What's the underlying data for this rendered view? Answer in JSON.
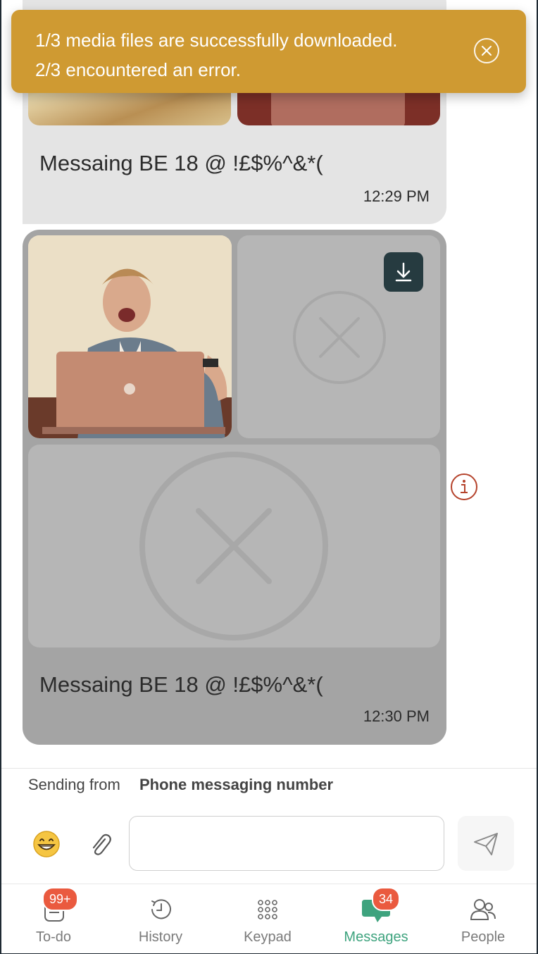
{
  "toast": {
    "line1": "1/3 media files are successfully downloaded.",
    "line2": "2/3 encountered an error."
  },
  "messages": [
    {
      "text": "Messaing BE 18 @ !£$%^&*(",
      "time": "12:29 PM"
    },
    {
      "text": "Messaing BE 18 @ !£$%^&*(",
      "time": "12:30 PM"
    }
  ],
  "composer": {
    "sending_label": "Sending from",
    "sending_number": "Phone messaging number",
    "input_value": "",
    "input_placeholder": ""
  },
  "nav": {
    "items": [
      {
        "label": "To-do",
        "badge": "99+"
      },
      {
        "label": "History"
      },
      {
        "label": "Keypad"
      },
      {
        "label": "Messages",
        "badge": "34",
        "active": true
      },
      {
        "label": "People"
      }
    ]
  },
  "colors": {
    "toast": "#cf9a32",
    "accent": "#3ea37e",
    "badge": "#ea5a3f",
    "error": "#b5432c"
  }
}
